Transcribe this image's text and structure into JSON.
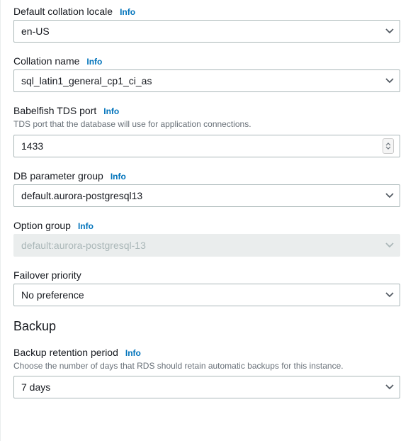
{
  "info_label": "Info",
  "fields": {
    "collation_locale": {
      "label": "Default collation locale",
      "value": "en-US"
    },
    "collation_name": {
      "label": "Collation name",
      "value": "sql_latin1_general_cp1_ci_as"
    },
    "tds_port": {
      "label": "Babelfish TDS port",
      "help": "TDS port that the database will use for application connections.",
      "value": "1433"
    },
    "param_group": {
      "label": "DB parameter group",
      "value": "default.aurora-postgresql13"
    },
    "option_group": {
      "label": "Option group",
      "value": "default:aurora-postgresql-13"
    },
    "failover": {
      "label": "Failover priority",
      "value": "No preference"
    },
    "backup_retention": {
      "label": "Backup retention period",
      "help": "Choose the number of days that RDS should retain automatic backups for this instance.",
      "value": "7 days"
    }
  },
  "sections": {
    "backup": "Backup"
  }
}
